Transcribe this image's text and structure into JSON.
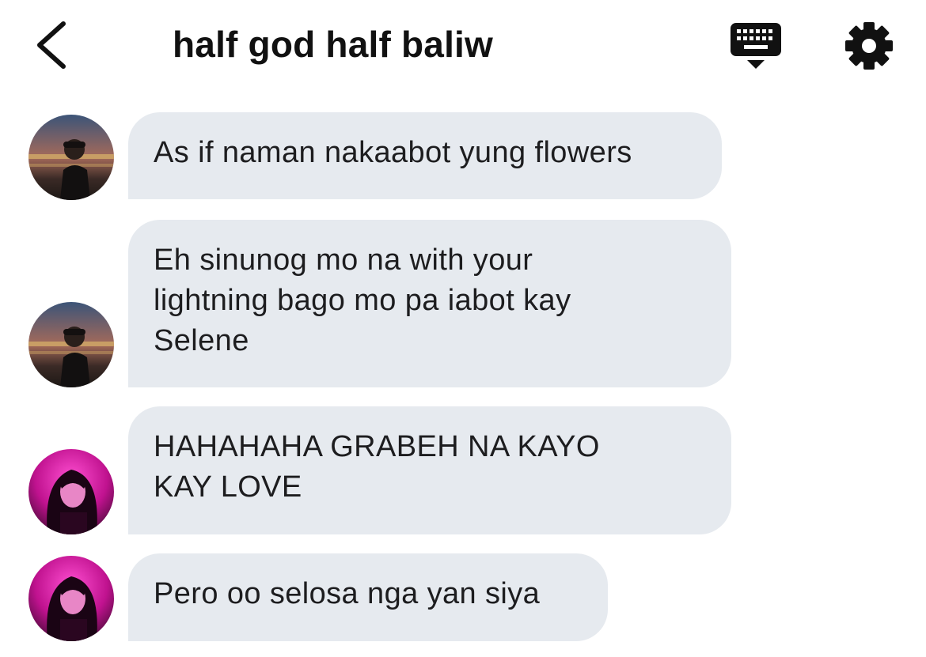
{
  "header": {
    "title": "half god half baliw"
  },
  "messages": [
    {
      "avatar": "male-avatar",
      "text": "As if naman nakaabot yung flowers"
    },
    {
      "avatar": "male-avatar",
      "text": "Eh sinunog mo na with your\nlightning bago mo pa iabot kay\nSelene"
    },
    {
      "avatar": "female-avatar",
      "text": "HAHAHAHA GRABEH NA KAYO\nKAY LOVE"
    },
    {
      "avatar": "female-avatar",
      "text": "Pero oo selosa nga yan siya"
    }
  ],
  "colors": {
    "bubble": "#e6eaef",
    "text": "#1d1d1f",
    "icon": "#111111",
    "female_avatar_accent": "#e31bb0"
  }
}
